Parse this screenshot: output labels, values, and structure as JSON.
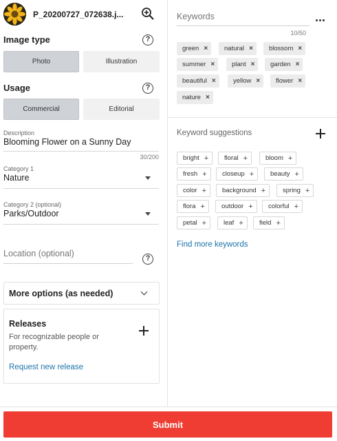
{
  "file": {
    "name": "P_20200727_072638.j..."
  },
  "image_type": {
    "label": "Image type",
    "options": [
      "Photo",
      "Illustration"
    ],
    "selected": "Photo"
  },
  "usage": {
    "label": "Usage",
    "options": [
      "Commercial",
      "Editorial"
    ],
    "selected": "Commercial"
  },
  "description": {
    "label": "Description",
    "value": "Blooming Flower on a Sunny Day",
    "counter": "30/200"
  },
  "category1": {
    "label": "Category 1",
    "value": "Nature"
  },
  "category2": {
    "label": "Category 2 (optional)",
    "value": "Parks/Outdoor"
  },
  "location": {
    "placeholder": "Location (optional)"
  },
  "more_options": {
    "label": "More options (as needed)"
  },
  "releases": {
    "title": "Releases",
    "description": "For recognizable people or property.",
    "link": "Request new release"
  },
  "keywords": {
    "label": "Keywords",
    "counter": "10/50",
    "items": [
      "green",
      "natural",
      "blossom",
      "summer",
      "plant",
      "garden",
      "beautiful",
      "yellow",
      "flower",
      "nature"
    ]
  },
  "suggestions": {
    "label": "Keyword suggestions",
    "items": [
      "bright",
      "floral",
      "bloom",
      "fresh",
      "closeup",
      "beauty",
      "color",
      "background",
      "spring",
      "flora",
      "outdoor",
      "colorful",
      "petal",
      "leaf",
      "field"
    ],
    "find_more": "Find more keywords"
  },
  "submit": {
    "label": "Submit"
  },
  "colors": {
    "accent": "#ef3d33",
    "link": "#1a73a8",
    "selected_segment": "#cfd2d6"
  }
}
